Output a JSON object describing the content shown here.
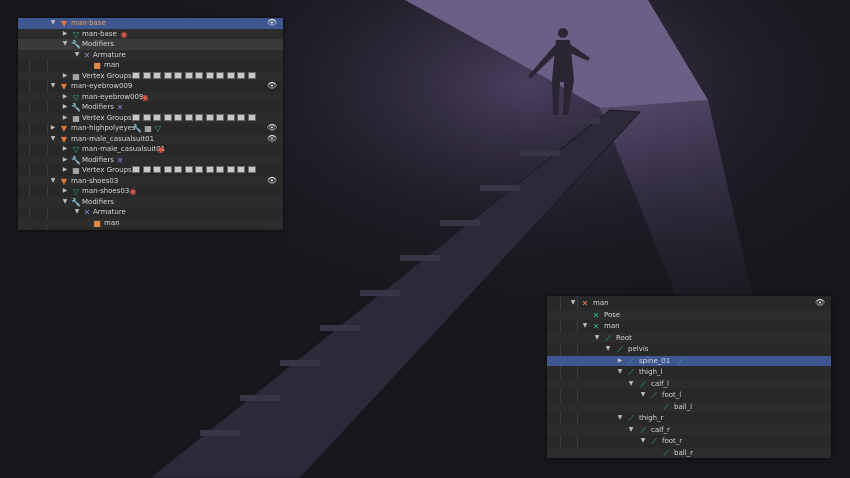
{
  "icons": {
    "expanded": "▼",
    "collapsed": "▶",
    "eye": "eye-icon",
    "mesh_object": "orange-triangle-icon",
    "mesh_data": "green-triangle-icon",
    "modifiers": "wrench-icon",
    "armature": "armature-icon",
    "vertex_groups": "vertex-groups-icon",
    "bone": "bone-icon",
    "material": "material-sphere-icon"
  },
  "colors": {
    "selection": "#3e5790",
    "panel_bg": "#282828",
    "selected_text": "#f0a04b",
    "bone_green": "#2fb89c"
  },
  "outliner_top": {
    "rows": [
      {
        "label": "man-base"
      },
      {
        "label": "man-base"
      },
      {
        "label": "Modifiers"
      },
      {
        "label": "Armature"
      },
      {
        "label": "man"
      },
      {
        "label": "Vertex Groups"
      },
      {
        "label": "man-eyebrow009"
      },
      {
        "label": "man-eyebrow009"
      },
      {
        "label": "Modifiers"
      },
      {
        "label": "Vertex Groups"
      },
      {
        "label": "man-highpolyeyes"
      },
      {
        "label": "man-male_casualsuit01"
      },
      {
        "label": "man-male_casualsuit01"
      },
      {
        "label": "Modifiers"
      },
      {
        "label": "Vertex Groups"
      },
      {
        "label": "man-shoes03"
      },
      {
        "label": "man-shoes03"
      },
      {
        "label": "Modifiers"
      },
      {
        "label": "Armature"
      },
      {
        "label": "man"
      }
    ]
  },
  "outliner_bottom": {
    "rows": [
      {
        "label": "man"
      },
      {
        "label": "Pose"
      },
      {
        "label": "man"
      },
      {
        "label": "Root"
      },
      {
        "label": "pelvis"
      },
      {
        "label": "spine_01"
      },
      {
        "label": "thigh_l"
      },
      {
        "label": "calf_l"
      },
      {
        "label": "foot_l"
      },
      {
        "label": "ball_l"
      },
      {
        "label": "thigh_r"
      },
      {
        "label": "calf_r"
      },
      {
        "label": "foot_r"
      },
      {
        "label": "ball_r"
      }
    ]
  }
}
